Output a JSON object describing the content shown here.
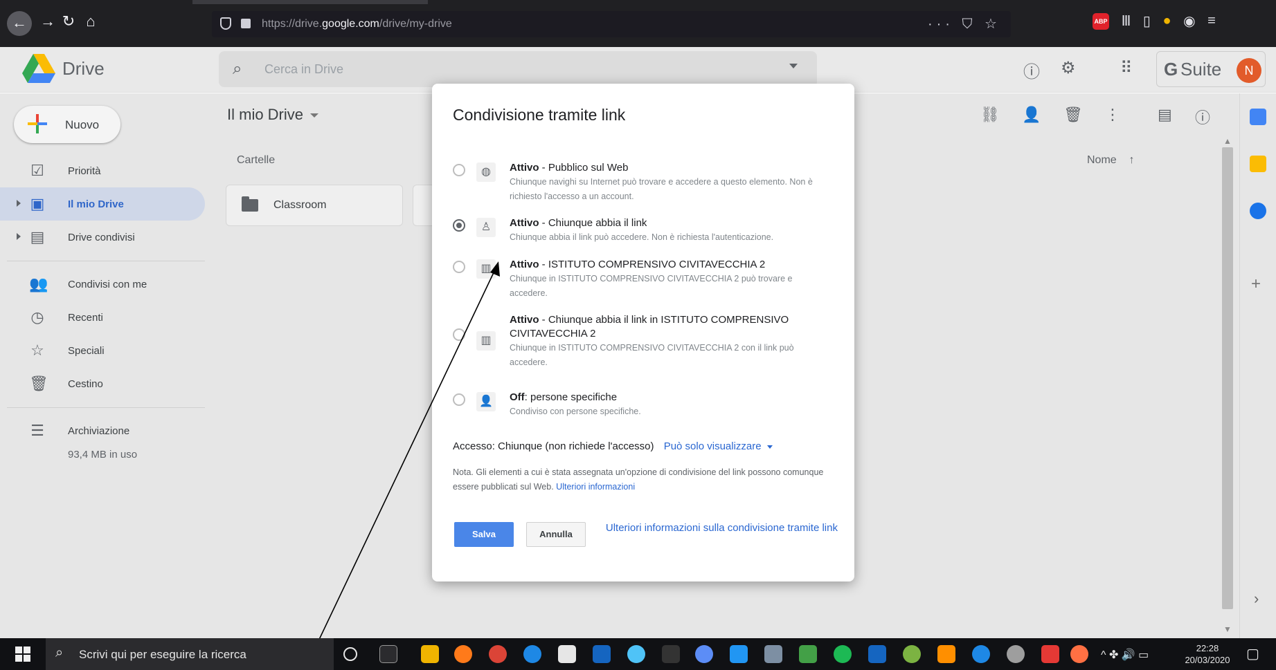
{
  "browser": {
    "url_prefix": "https://drive.",
    "url_domain": "google.com",
    "url_path": "/drive/my-drive",
    "page_actions": "··· ⛉ ☆"
  },
  "header": {
    "app_name": "Drive",
    "search_placeholder": "Cerca in Drive",
    "suite_g": "G",
    "suite_name": "Suite",
    "avatar_letter": "N"
  },
  "sidebar": {
    "new_label": "Nuovo",
    "items": [
      {
        "label": "Priorità"
      },
      {
        "label": "Il mio Drive"
      },
      {
        "label": "Drive condivisi"
      },
      {
        "label": "Condivisi con me"
      },
      {
        "label": "Recenti"
      },
      {
        "label": "Speciali"
      },
      {
        "label": "Cestino"
      },
      {
        "label": "Archiviazione"
      }
    ],
    "storage_used": "93,4 MB in uso"
  },
  "main": {
    "title": "Il mio Drive",
    "section_label": "Cartelle",
    "sort_label": "Nome",
    "sort_arrow": "↑",
    "folders": [
      {
        "name": "Classroom"
      }
    ]
  },
  "dialog": {
    "title": "Condivisione tramite link",
    "options": [
      {
        "state": "Attivo",
        "title": " - Pubblico sul Web",
        "desc": "Chiunque navighi su Internet può trovare e accedere a questo elemento. Non è richiesto l'accesso a un account.",
        "selected": false
      },
      {
        "state": "Attivo",
        "title": " - Chiunque abbia il link",
        "desc": "Chiunque abbia il link può accedere. Non è richiesta l'autenticazione.",
        "selected": true
      },
      {
        "state": "Attivo",
        "title": " - ISTITUTO COMPRENSIVO CIVITAVECCHIA 2",
        "desc": "Chiunque in ISTITUTO COMPRENSIVO CIVITAVECCHIA 2 può trovare e accedere.",
        "selected": false
      },
      {
        "state": "Attivo",
        "title": " - Chiunque abbia il link in ISTITUTO COMPRENSIVO CIVITAVECCHIA 2",
        "desc": "Chiunque in ISTITUTO COMPRENSIVO CIVITAVECCHIA 2 con il link può accedere.",
        "selected": false
      },
      {
        "state": "Off",
        "title": ": persone specifiche",
        "desc": "Condiviso con persone specifiche.",
        "selected": false
      }
    ],
    "access_label": "Accesso:",
    "access_value": "Chiunque (non richiede l'accesso)",
    "access_mode": "Può solo visualizzare",
    "note": "Nota. Gli elementi a cui è stata assegnata un'opzione di condivisione del link possono comunque essere pubblicati sul Web.",
    "note_link": "Ulteriori informazioni",
    "save_label": "Salva",
    "cancel_label": "Annulla",
    "more_link": "Ulteriori informazioni sulla condivisione tramite link"
  },
  "taskbar": {
    "search_placeholder": "Scrivi qui per eseguire la ricerca",
    "time": "22:28",
    "date": "20/03/2020"
  },
  "colors": {
    "accent_blue": "#4a86e8",
    "link_blue": "#2a67d1",
    "avatar_orange": "#e25b2a"
  }
}
